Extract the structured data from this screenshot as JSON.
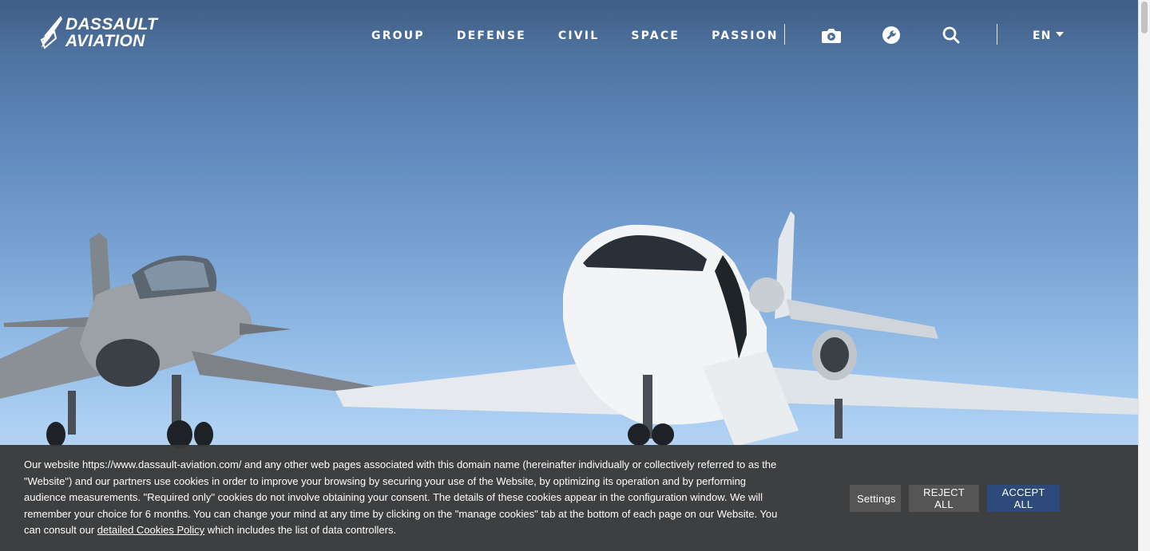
{
  "header": {
    "logo": {
      "line1": "DASSAULT",
      "line2": "AVIATION"
    },
    "nav": [
      {
        "label": "GROUP"
      },
      {
        "label": "DEFENSE"
      },
      {
        "label": "CIVIL"
      },
      {
        "label": "SPACE"
      },
      {
        "label": "PASSION"
      }
    ],
    "icons": [
      "camera-icon",
      "wrench-icon",
      "search-icon"
    ],
    "language": "EN"
  },
  "hero": {
    "image": "rafale-and-falcon-aircraft-on-tarmac"
  },
  "cookie_banner": {
    "text_before_link": "Our website https://www.dassault-aviation.com/ and any other web pages associated with this domain name (hereinafter individually or collectively referred to as the \"Website\") and our partners use cookies in order to improve your browsing by securing your use of the Website, by optimizing its operation and by performing audience measurements. \"Required only\" cookies do not involve obtaining your consent. The details of these cookies appear in the configuration window. We will remember your choice for 6 months. You can change your mind at any time by clicking on the \"manage cookies\" tab at the bottom of each page on our Website. You can consult our ",
    "link_text": "detailed Cookies Policy",
    "text_after_link": " which includes the list of data controllers.",
    "settings_label": "Settings",
    "reject_label": "REJECT ALL",
    "accept_label": "ACCEPT ALL"
  },
  "colors": {
    "sky_top": "#3f5d86",
    "sky_bottom": "#c2def6",
    "banner_bg": "#3a3a3a",
    "button_grey": "#555555",
    "accept_blue": "#2d4a7a"
  }
}
